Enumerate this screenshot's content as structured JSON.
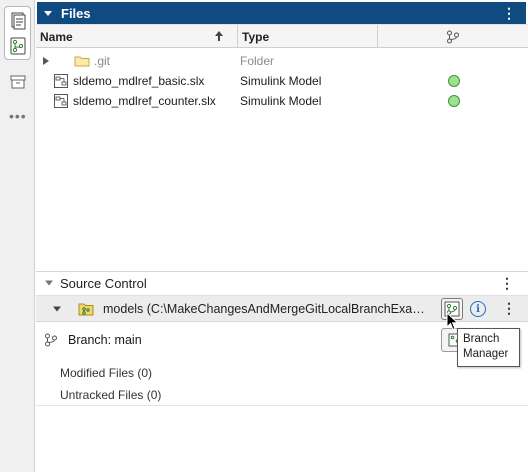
{
  "files_panel": {
    "title": "Files",
    "columns": {
      "name": "Name",
      "type": "Type"
    },
    "rows": [
      {
        "name": ".git",
        "type": "Folder",
        "kind": "folder",
        "status": ""
      },
      {
        "name": "sldemo_mdlref_basic.slx",
        "type": "Simulink Model",
        "kind": "model",
        "status": "green"
      },
      {
        "name": "sldemo_mdlref_counter.slx",
        "type": "Simulink Model",
        "kind": "model",
        "status": "green"
      }
    ]
  },
  "source_control": {
    "title": "Source Control",
    "repo_label": "models (C:\\MakeChangesAndMergeGitLocalBranchExamp...",
    "branch_label": "Branch: main",
    "modified_files": "Modified Files (0)",
    "untracked_files": "Untracked Files (0)",
    "tooltip": {
      "line1": "Branch",
      "line2": "Manager"
    }
  },
  "colors": {
    "header_bg": "#0f4a80",
    "status_green": "#9ee08f",
    "accent_blue": "#1f6fc5"
  }
}
